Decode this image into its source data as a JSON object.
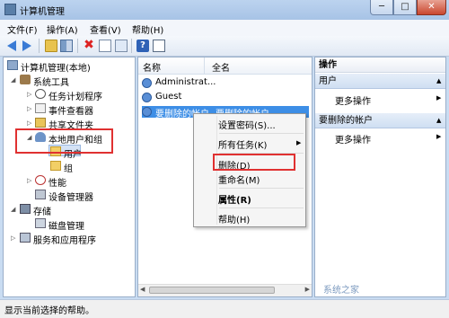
{
  "window": {
    "title": "计算机管理",
    "min_label": "─",
    "max_label": "□",
    "close_label": "✕"
  },
  "menu": [
    "文件(F)",
    "操作(A)",
    "查看(V)",
    "帮助(H)"
  ],
  "tree": {
    "root": "计算机管理(本地)",
    "system_tools": "系统工具",
    "task_scheduler": "任务计划程序",
    "event_viewer": "事件查看器",
    "shared_folders": "共享文件夹",
    "local_users_groups": "本地用户和组",
    "users": "用户",
    "groups": "组",
    "performance": "性能",
    "device_manager": "设备管理器",
    "storage": "存储",
    "disk_management": "磁盘管理",
    "services_apps": "服务和应用程序"
  },
  "list": {
    "col_name": "名称",
    "col_fullname": "全名",
    "rows": [
      {
        "name": "Administrat...",
        "fullname": ""
      },
      {
        "name": "Guest",
        "fullname": ""
      },
      {
        "name": "要删除的帐户",
        "fullname": "要删除的帐户"
      }
    ]
  },
  "actions": {
    "header": "操作",
    "group1": "用户",
    "group1_more": "更多操作",
    "group2": "要删除的帐户",
    "group2_more": "更多操作"
  },
  "context_menu": {
    "set_password": "设置密码(S)...",
    "all_tasks": "所有任务(K)",
    "delete": "删除(D)",
    "rename": "重命名(M)",
    "properties": "属性(R)",
    "help": "帮助(H)"
  },
  "status": "显示当前选择的帮助。",
  "watermark": "系统之家",
  "colors": {
    "selection": "#3d8ee6",
    "highlight_box": "#e03131",
    "title_bar": "#bcd3ef"
  }
}
